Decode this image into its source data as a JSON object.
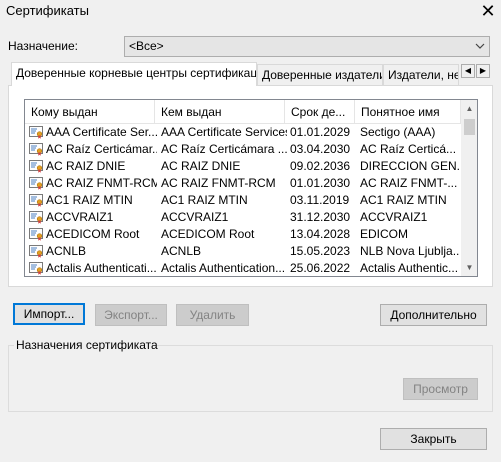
{
  "window": {
    "title": "Сертификаты",
    "close_glyph": "✕"
  },
  "purpose": {
    "label": "Назначение:",
    "value": "<Все>"
  },
  "tabs": [
    {
      "label": "Доверенные корневые центры сертификации",
      "active": true
    },
    {
      "label": "Доверенные издатели",
      "active": false
    },
    {
      "label": "Издатели, не",
      "active": false
    }
  ],
  "tab_scroll": {
    "left": "◀",
    "right": "▶"
  },
  "columns": [
    "Кому выдан",
    "Кем выдан",
    "Срок де...",
    "Понятное имя"
  ],
  "rows": [
    [
      "AAA Certificate Ser...",
      "AAA Certificate Services",
      "01.01.2029",
      "Sectigo (AAA)"
    ],
    [
      "AC Raíz Certicámar...",
      "AC Raíz Certicámara ...",
      "03.04.2030",
      "AC Raíz Certicá..."
    ],
    [
      "AC RAIZ DNIE",
      "AC RAIZ DNIE",
      "09.02.2036",
      "DIRECCION GEN..."
    ],
    [
      "AC RAIZ FNMT-RCM",
      "AC RAIZ FNMT-RCM",
      "01.01.2030",
      "AC RAIZ FNMT-..."
    ],
    [
      "AC1 RAIZ MTIN",
      "AC1 RAIZ MTIN",
      "03.11.2019",
      "AC1 RAIZ MTIN"
    ],
    [
      "ACCVRAIZ1",
      "ACCVRAIZ1",
      "31.12.2030",
      "ACCVRAIZ1"
    ],
    [
      "ACEDICOM Root",
      "ACEDICOM Root",
      "13.04.2028",
      "EDICOM"
    ],
    [
      "ACNLB",
      "ACNLB",
      "15.05.2023",
      "NLB Nova Ljubljа..."
    ],
    [
      "Actalis Authenticati...",
      "Actalis Authentication...",
      "25.06.2022",
      "Actalis Authentic..."
    ]
  ],
  "buttons": {
    "import": "Импорт...",
    "export": "Экспорт...",
    "delete": "Удалить",
    "advanced": "Дополнительно",
    "view": "Просмотр",
    "close": "Закрыть"
  },
  "cert_purposes": {
    "label": "Назначения сертификата"
  },
  "scroll_glyphs": {
    "up": "▲",
    "down": "▼"
  },
  "colors": {
    "accent": "#0078d7",
    "window_bg": "#f0f0f0"
  }
}
